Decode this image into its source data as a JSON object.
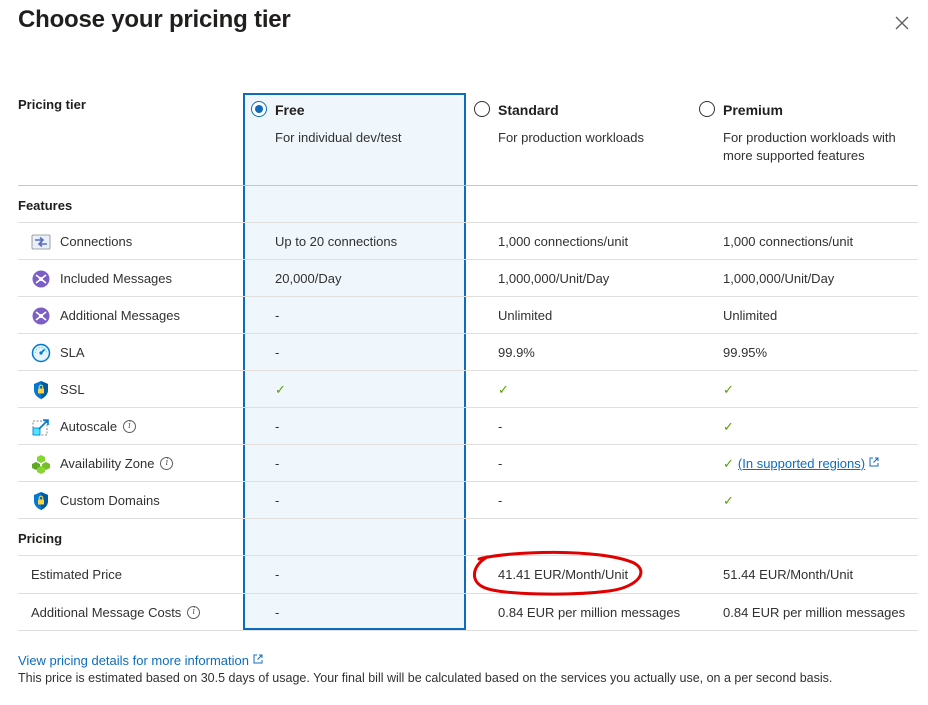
{
  "dialog": {
    "title": "Choose your pricing tier",
    "close_icon": "close-icon"
  },
  "table": {
    "pricing_tier_label": "Pricing tier",
    "tiers": [
      {
        "name": "Free",
        "description": "For individual dev/test",
        "selected": true
      },
      {
        "name": "Standard",
        "description": "For production workloads",
        "selected": false
      },
      {
        "name": "Premium",
        "description": "For production workloads with more supported features",
        "selected": false
      }
    ],
    "features_label": "Features",
    "features": [
      {
        "icon": "connections-icon",
        "label": "Connections",
        "info": false,
        "values": [
          "Up to 20 connections",
          "1,000 connections/unit",
          "1,000 connections/unit"
        ]
      },
      {
        "icon": "messages-icon",
        "label": "Included Messages",
        "info": false,
        "values": [
          "20,000/Day",
          "1,000,000/Unit/Day",
          "1,000,000/Unit/Day"
        ]
      },
      {
        "icon": "messages-icon",
        "label": "Additional Messages",
        "info": false,
        "values": [
          "-",
          "Unlimited",
          "Unlimited"
        ]
      },
      {
        "icon": "sla-gauge-icon",
        "label": "SLA",
        "info": false,
        "values": [
          "-",
          "99.9%",
          "99.95%"
        ]
      },
      {
        "icon": "shield-icon",
        "label": "SSL",
        "info": false,
        "values": [
          "✓",
          "✓",
          "✓"
        ]
      },
      {
        "icon": "autoscale-icon",
        "label": "Autoscale",
        "info": true,
        "values": [
          "-",
          "-",
          "✓"
        ]
      },
      {
        "icon": "availability-zone-icon",
        "label": "Availability Zone",
        "info": true,
        "values": [
          "-",
          "-",
          "✓"
        ]
      },
      {
        "icon": "shield-icon",
        "label": "Custom Domains",
        "info": false,
        "values": [
          "-",
          "-",
          "✓"
        ]
      }
    ],
    "availability_zone_link": "(In supported regions)",
    "pricing_label": "Pricing",
    "pricing_rows": [
      {
        "label": "Estimated Price",
        "info": false,
        "values": [
          "-",
          "41.41 EUR/Month/Unit",
          "51.44 EUR/Month/Unit"
        ]
      },
      {
        "label": "Additional Message Costs",
        "info": true,
        "values": [
          "-",
          "0.84 EUR per million messages",
          "0.84 EUR per million messages"
        ]
      }
    ]
  },
  "footer": {
    "link_text": "View pricing details for more information",
    "note": "This price is estimated based on 30.5 days of usage. Your final bill will be calculated based on the services you actually use, on a per second basis."
  },
  "colors": {
    "accent": "#0f6cbd",
    "selected_bg": "#eff6fc",
    "check": "#57a300",
    "annotation": "#e00000"
  }
}
